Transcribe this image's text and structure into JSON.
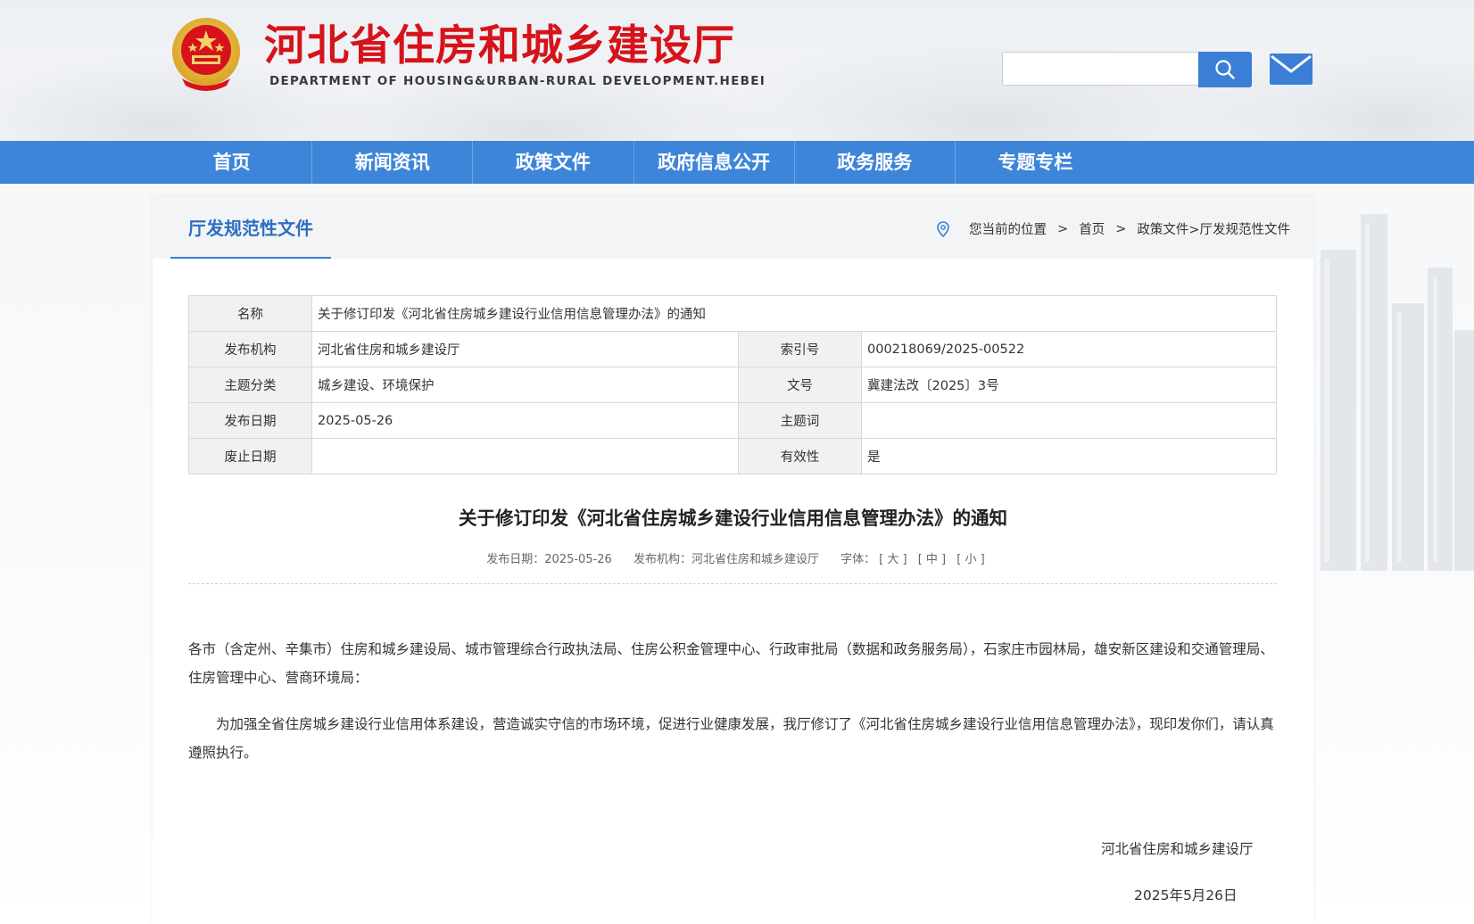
{
  "header": {
    "site_title": "河北省住房和城乡建设厅",
    "site_subtitle": "DEPARTMENT OF HOUSING&URBAN-RURAL DEVELOPMENT.HEBEI",
    "search_placeholder": ""
  },
  "nav": {
    "items": [
      "首页",
      "新闻资讯",
      "政策文件",
      "政府信息公开",
      "政务服务",
      "专题专栏"
    ]
  },
  "section": {
    "title": "厅发规范性文件"
  },
  "breadcrumb": {
    "prefix": "您当前的位置",
    "sep": ">",
    "home": "首页",
    "path": "政策文件>厅发规范性文件"
  },
  "info": {
    "name_label": "名称",
    "name_value": "关于修订印发《河北省住房城乡建设行业信用信息管理办法》的通知",
    "org_label": "发布机构",
    "org_value": "河北省住房和城乡建设厅",
    "index_label": "索引号",
    "index_value": "000218069/2025-00522",
    "topic_label": "主题分类",
    "topic_value": "城乡建设、环境保护",
    "docno_label": "文号",
    "docno_value": "冀建法改〔2025〕3号",
    "date_label": "发布日期",
    "date_value": "2025-05-26",
    "keyword_label": "主题词",
    "keyword_value": "",
    "expire_label": "废止日期",
    "expire_value": "",
    "valid_label": "有效性",
    "valid_value": "是"
  },
  "article": {
    "title": "关于修订印发《河北省住房城乡建设行业信用信息管理办法》的通知",
    "meta_date": "发布日期：2025-05-26",
    "meta_org": "发布机构：河北省住房和城乡建设厅",
    "font_label": "字体：",
    "font_large": "[ 大 ]",
    "font_medium": "[ 中 ]",
    "font_small": "[ 小 ]",
    "para1": "各市（含定州、辛集市）住房和城乡建设局、城市管理综合行政执法局、住房公积金管理中心、行政审批局（数据和政务服务局），石家庄市园林局，雄安新区建设和交通管理局、住房管理中心、营商环境局：",
    "para2": "为加强全省住房城乡建设行业信用体系建设，营造诚实守信的市场环境，促进行业健康发展，我厅修订了《河北省住房城乡建设行业信用信息管理办法》，现印发你们，请认真遵照执行。",
    "sign_org": "河北省住房和城乡建设厅",
    "sign_date": "2025年5月26日"
  },
  "colors": {
    "brand_red": "#d6131a",
    "nav_blue": "#3d85d8",
    "accent_blue": "#2b6fc4"
  }
}
